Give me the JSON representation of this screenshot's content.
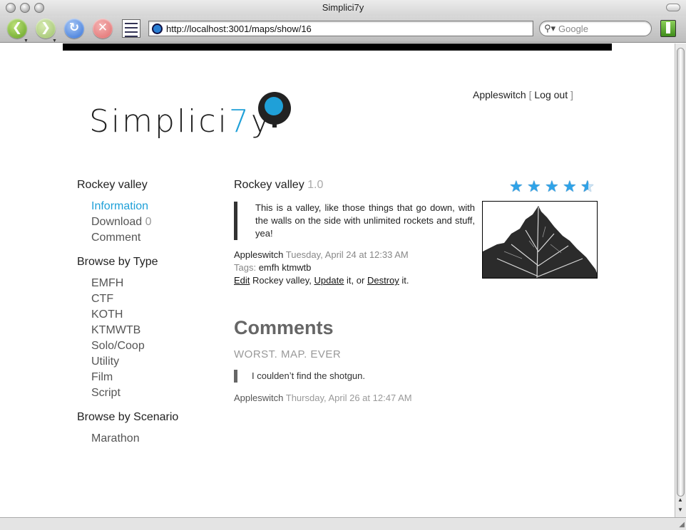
{
  "window": {
    "title": "Simplici7y"
  },
  "toolbar": {
    "url": "http://localhost:3001/maps/show/16",
    "search_placeholder": "Google",
    "back_icon": "back-arrow-icon",
    "forward_icon": "forward-arrow-icon",
    "reload_icon": "reload-icon",
    "stop_icon": "stop-icon",
    "bookmark_icon": "bookmark-icon"
  },
  "site": {
    "logo_prefix": "Simplici",
    "logo_seven": "7",
    "logo_suffix": "y",
    "accent_color": "#1fa0d8"
  },
  "user": {
    "name": "Appleswitch",
    "bracket_open": "[",
    "logout": "Log out",
    "bracket_close": "]"
  },
  "sidebar": {
    "item_heading": "Rockey valley",
    "item_links": [
      {
        "label": "Information",
        "active": true
      },
      {
        "label": "Download",
        "count": "0"
      },
      {
        "label": "Comment"
      }
    ],
    "type_heading": "Browse by Type",
    "types": [
      "EMFH",
      "CTF",
      "KOTH",
      "KTMWTB",
      "Solo/Coop",
      "Utility",
      "Film",
      "Script"
    ],
    "scenario_heading": "Browse by Scenario",
    "scenarios": [
      "Marathon"
    ]
  },
  "item": {
    "title": "Rockey valley",
    "version": "1.0",
    "rating": 0.9,
    "description": "This is a valley, like those things that go down, with the walls on the side with unlimited rockets and stuff, yea!",
    "author": "Appleswitch",
    "date": "Tuesday, April 24 at 12:33 AM",
    "tags_label": "Tags:",
    "tags": "emfh ktmwtb",
    "actions": {
      "edit": "Edit",
      "name": "Rockey valley,",
      "update": "Update",
      "mid": "it, or",
      "destroy": "Destroy",
      "end": "it."
    }
  },
  "comments": {
    "heading": "Comments",
    "list": [
      {
        "title": "WORST. MAP. EVER",
        "body": "I couldenʼt find the shotgun.",
        "author": "Appleswitch",
        "date": "Thursday, April 26 at 12:47 AM"
      }
    ]
  }
}
